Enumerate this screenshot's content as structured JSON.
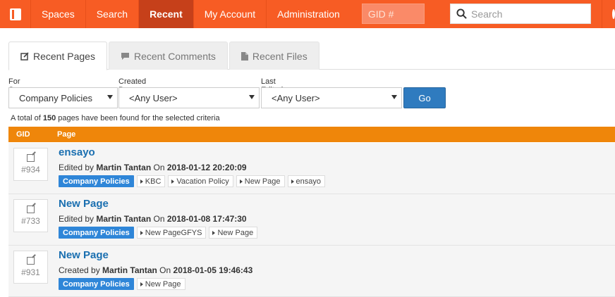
{
  "nav": {
    "items": [
      "Spaces",
      "Search",
      "Recent",
      "My Account",
      "Administration"
    ],
    "active": "Recent",
    "gid_placeholder": "GID #",
    "search_placeholder": "Search"
  },
  "tabs": [
    {
      "label": "Recent Pages",
      "active": true
    },
    {
      "label": "Recent Comments",
      "active": false
    },
    {
      "label": "Recent Files",
      "active": false
    }
  ],
  "filters": {
    "space_label": "For Space",
    "space_value": "Company Policies",
    "created_label": "Created By",
    "created_value": "<Any User>",
    "edited_label": "Last Edited By",
    "edited_value": "<Any User>",
    "go_label": "Go"
  },
  "summary": {
    "prefix": "A total of ",
    "count": "150",
    "suffix": " pages have been found for the selected criteria"
  },
  "table": {
    "col_gid": "GID",
    "col_page": "Page",
    "rows": [
      {
        "gid": "#934",
        "title": "ensayo",
        "action": "Edited by ",
        "user": "Martin Tantan",
        "on": " On ",
        "date": "2018-01-12 20:20:09",
        "space": "Company Policies",
        "labels": [
          "KBC",
          "Vacation Policy",
          "New Page",
          "ensayo"
        ]
      },
      {
        "gid": "#733",
        "title": "New Page",
        "action": "Edited by ",
        "user": "Martin Tantan",
        "on": " On ",
        "date": "2018-01-08 17:47:30",
        "space": "Company Policies",
        "labels": [
          "New PageGFYS",
          "New Page"
        ]
      },
      {
        "gid": "#931",
        "title": "New Page",
        "action": "Created by ",
        "user": "Martin Tantan",
        "on": " On ",
        "date": "2018-01-05 19:46:43",
        "space": "Company Policies",
        "labels": [
          "New Page"
        ]
      }
    ]
  },
  "colors": {
    "navbar": "#f75c24",
    "table_header": "#ef860a",
    "link": "#1a6fb0",
    "space_label": "#2f86d8",
    "go_button": "#2f7bbf"
  }
}
